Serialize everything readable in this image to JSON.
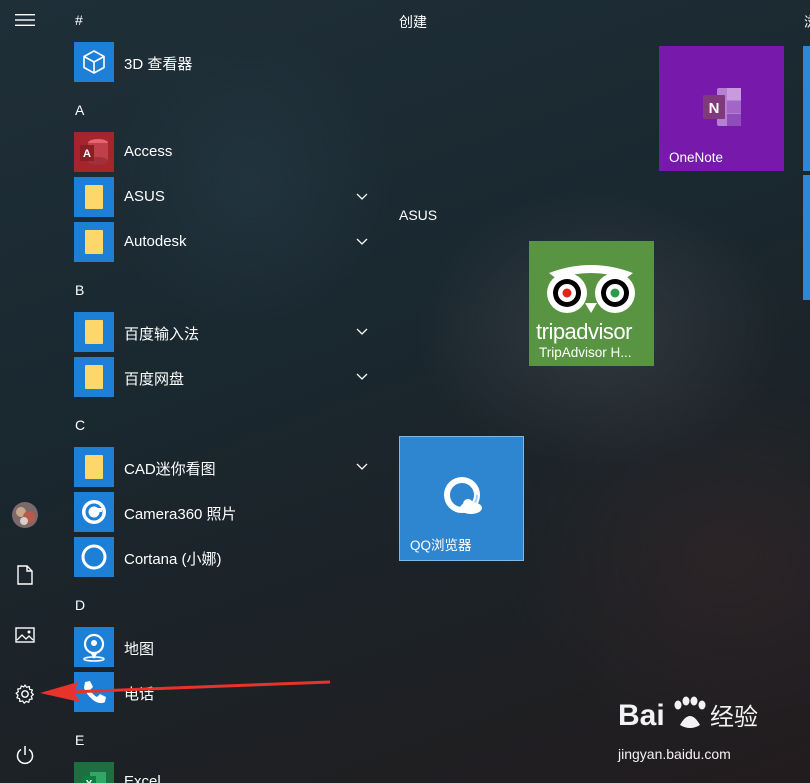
{
  "rail": {
    "menu_icon": "hamburger-icon",
    "avatar_icon": "user-avatar",
    "documents_icon": "document-icon",
    "pictures_icon": "picture-icon",
    "settings_icon": "gear-icon",
    "power_icon": "power-icon"
  },
  "app_list": {
    "sections": [
      {
        "header": "#",
        "apps": [
          {
            "label": "3D 查看器",
            "icon": "cube-icon",
            "tile_color": "#1e7fd6"
          }
        ]
      },
      {
        "header": "A",
        "apps": [
          {
            "label": "Access",
            "icon": "access-icon",
            "tile_color": "#a4262c"
          },
          {
            "label": "ASUS",
            "icon": "folder-icon",
            "tile_color": "#1e7fd6",
            "expandable": true
          },
          {
            "label": "Autodesk",
            "icon": "folder-icon",
            "tile_color": "#1e7fd6",
            "expandable": true
          }
        ]
      },
      {
        "header": "B",
        "apps": [
          {
            "label": "百度输入法",
            "icon": "folder-icon",
            "tile_color": "#1e7fd6",
            "expandable": true
          },
          {
            "label": "百度网盘",
            "icon": "folder-icon",
            "tile_color": "#1e7fd6",
            "expandable": true
          }
        ]
      },
      {
        "header": "C",
        "apps": [
          {
            "label": "CAD迷你看图",
            "icon": "folder-icon",
            "tile_color": "#1e7fd6",
            "expandable": true
          },
          {
            "label": "Camera360 照片",
            "icon": "camera360-icon",
            "tile_color": "#1e7fd6"
          },
          {
            "label": "Cortana (小娜)",
            "icon": "cortana-icon",
            "tile_color": "#1e7fd6"
          }
        ]
      },
      {
        "header": "D",
        "apps": [
          {
            "label": "地图",
            "icon": "map-icon",
            "tile_color": "#1e7fd6"
          },
          {
            "label": "电话",
            "icon": "phone-icon",
            "tile_color": "#1e7fd6"
          }
        ]
      },
      {
        "header": "E",
        "apps": [
          {
            "label": "Excel",
            "icon": "excel-icon",
            "tile_color": "#1d6f42"
          }
        ]
      }
    ]
  },
  "tiles": {
    "group_create": "创建",
    "group_asus": "ASUS",
    "group_partial": "浏",
    "onenote": {
      "label": "OneNote",
      "color": "#7719aa"
    },
    "tripadvisor": {
      "label": "TripAdvisor H...",
      "brand": "tripadvisor",
      "color": "#589442"
    },
    "qq_browser": {
      "label": "QQ浏览器",
      "color": "#2e86d1"
    }
  },
  "watermark": {
    "brand": "Bai du 经验",
    "url": "jingyan.baidu.com"
  }
}
